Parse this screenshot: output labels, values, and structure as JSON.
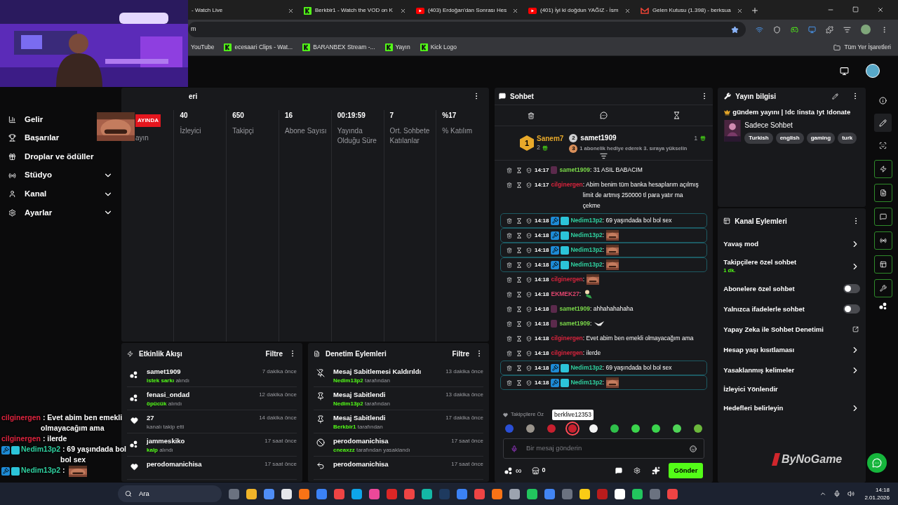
{
  "browser": {
    "tabs": [
      {
        "title": "- Watch Live",
        "selected": false
      },
      {
        "title": "Berkbir1 - Watch the VOD on K",
        "selected": false
      },
      {
        "title": "(403) Erdoğan'dan Sonrası Hes",
        "selected": false
      },
      {
        "title": "(401) İyi ki doğdun YAĞIZ - İsm",
        "selected": false
      },
      {
        "title": "Gelen Kutusu (1.398) - berksua",
        "selected": false
      }
    ],
    "address": "m",
    "bookmarks": [
      "YouTube",
      "ecesaari Clips - Wat...",
      "BARANBEX Stream -...",
      "Yayın",
      "Kick Logo"
    ],
    "all_bookmarks": "Tüm Yer İşaretleri"
  },
  "sidebar": [
    {
      "label": "Gelir",
      "kind": "link"
    },
    {
      "label": "Başarılar",
      "kind": "link"
    },
    {
      "label": "Droplar ve ödüller",
      "kind": "link"
    },
    {
      "label": "Stüdyo",
      "kind": "group",
      "expanded": false
    },
    {
      "label": "Kanal",
      "kind": "group",
      "expanded": false
    },
    {
      "label": "Ayarlar",
      "kind": "group",
      "expanded": false
    }
  ],
  "stats": {
    "title": "eri",
    "live_badge": "AYINDA",
    "live_label": "ayın",
    "items": [
      {
        "value": "40",
        "label": "İzleyici"
      },
      {
        "value": "650",
        "label": "Takipçi"
      },
      {
        "value": "16",
        "label": "Abone Sayısı"
      },
      {
        "value": "00:19:59",
        "label": "Yayında Olduğu Süre"
      },
      {
        "value": "7",
        "label": "Ort. Sohbete Katılanlar"
      },
      {
        "value": "%17",
        "label": "% Katılım"
      }
    ]
  },
  "activity": {
    "title": "Etkinlik Akışı",
    "filter": "Filtre",
    "items": [
      {
        "user": "samet1909",
        "kind": "gift",
        "highlight": "istek sarkı",
        "detail": "alındı",
        "time": "7 dakika önce"
      },
      {
        "user": "fenasi_ondad",
        "kind": "gift",
        "highlight": "öpücük",
        "detail": "alındı",
        "time": "12 dakika önce"
      },
      {
        "user": "27",
        "kind": "follow",
        "detail": "kanalı takip etti",
        "time": "14 dakika önce"
      },
      {
        "user": "jammeskiko",
        "kind": "gift",
        "highlight": "kalp",
        "detail": "alındı",
        "time": "17 saat önce"
      },
      {
        "user": "perodomanichisa",
        "kind": "follow",
        "time": "17 saat önce"
      }
    ]
  },
  "moderation": {
    "title": "Denetim Eylemleri",
    "filter": "Filtre",
    "items": [
      {
        "title": "Mesaj Sabitlemesi Kaldırıldı",
        "kind": "unpin",
        "actor": "Nedim13p2",
        "detail": "tarafından",
        "time": "13 dakika önce"
      },
      {
        "title": "Mesaj Sabitlendi",
        "kind": "pin",
        "actor": "Nedim13p2",
        "detail": "tarafından",
        "time": "13 dakika önce"
      },
      {
        "title": "Mesaj Sabitlendi",
        "kind": "pin",
        "actor": "Berkbir1",
        "detail": "tarafından",
        "time": "17 dakika önce"
      },
      {
        "title": "perodomanichisa",
        "kind": "ban",
        "actor": "cneaxzz",
        "detail": "tarafından yasaklandı",
        "time": "17 saat önce"
      },
      {
        "title": "perodomanichisa",
        "kind": "undo",
        "time": "17 saat önce"
      }
    ]
  },
  "chat": {
    "title": "Sohbet",
    "leader": {
      "rank": "1",
      "name": "Sanem7",
      "count": "2"
    },
    "runner_up": {
      "rank": "2",
      "name": "samet1909",
      "count": "1"
    },
    "next": {
      "rank": "3",
      "text": "1 abonelik hediye ederek 3. sıraya yükselin"
    },
    "messages": [
      {
        "time": "14:17",
        "user": "samet1909",
        "color": "#7bd94a",
        "avatar": true,
        "badges": false,
        "highlighted": false,
        "text": ": 31 ASIL BABACIM",
        "kind": "text"
      },
      {
        "time": "14:17",
        "user": "cilginergen",
        "color": "#d9243d",
        "avatar": false,
        "badges": false,
        "highlighted": false,
        "text": ": Abim benim tüm banka hesaplarım açılmış limit de artmış 250000 tl para yatır ma çekme",
        "kind": "text"
      },
      {
        "time": "14:18",
        "user": "Nedim13p2",
        "color": "#2fcf9f",
        "avatar": false,
        "badges": true,
        "highlighted": true,
        "text": ": 69 yaşındada bol bol sex",
        "kind": "text"
      },
      {
        "time": "14:18",
        "user": "Nedim13p2",
        "color": "#2fcf9f",
        "avatar": false,
        "badges": true,
        "highlighted": true,
        "text": ":",
        "kind": "face"
      },
      {
        "time": "14:18",
        "user": "Nedim13p2",
        "color": "#2fcf9f",
        "avatar": false,
        "badges": true,
        "highlighted": true,
        "text": ":",
        "kind": "face"
      },
      {
        "time": "14:18",
        "user": "Nedim13p2",
        "color": "#2fcf9f",
        "avatar": false,
        "badges": true,
        "highlighted": true,
        "text": ":",
        "kind": "face"
      },
      {
        "time": "14:18",
        "user": "cilginergen",
        "color": "#d9243d",
        "avatar": false,
        "badges": false,
        "highlighted": false,
        "text": ":",
        "kind": "face"
      },
      {
        "time": "14:18",
        "user": "EKMEK27",
        "color": "#e0456e",
        "avatar": false,
        "badges": false,
        "highlighted": false,
        "text": ":",
        "kind": "figure"
      },
      {
        "time": "14:18",
        "user": "samet1909",
        "color": "#7bd94a",
        "avatar": true,
        "badges": false,
        "highlighted": false,
        "text": ": ahhahahahaha",
        "kind": "text"
      },
      {
        "time": "14:18",
        "user": "samet1909",
        "color": "#7bd94a",
        "avatar": true,
        "badges": false,
        "highlighted": false,
        "text": ":",
        "kind": "bird"
      },
      {
        "time": "14:18",
        "user": "cilginergen",
        "color": "#d9243d",
        "avatar": false,
        "badges": false,
        "highlighted": false,
        "text": ": Evet abim ben emekli olmayacağım ama",
        "kind": "text"
      },
      {
        "time": "14:18",
        "user": "cilginergen",
        "color": "#d9243d",
        "avatar": false,
        "badges": false,
        "highlighted": false,
        "text": ": ilerde",
        "kind": "text"
      },
      {
        "time": "14:18",
        "user": "Nedim13p2",
        "color": "#2fcf9f",
        "avatar": false,
        "badges": true,
        "highlighted": true,
        "text": ": 69 yaşındada bol bol sex",
        "kind": "text"
      },
      {
        "time": "14:18",
        "user": "Nedim13p2",
        "color": "#2fcf9f",
        "avatar": false,
        "badges": true,
        "highlighted": true,
        "text": ":",
        "kind": "face"
      }
    ],
    "emote_label": "Takipçilere Öz",
    "tooltip": "berklive12353",
    "emotes": [
      {
        "color": "#2a4fd6",
        "hovered": false
      },
      {
        "color": "#9a948c",
        "hovered": false
      },
      {
        "color": "#c8202f",
        "hovered": false
      },
      {
        "color": "#c8202e",
        "hovered": true
      },
      {
        "color": "#f4f4f4",
        "hovered": false
      },
      {
        "color": "#2fbf4a",
        "hovered": false
      },
      {
        "color": "#3bd44c",
        "hovered": false
      },
      {
        "color": "#3bd44d",
        "hovered": false
      },
      {
        "color": "#4fd457",
        "hovered": false
      },
      {
        "color": "#6bb83c",
        "hovered": false
      }
    ],
    "input": {
      "placeholder": "Bir mesaj gönderin"
    },
    "points": "∞",
    "store_count": "0",
    "send": "Gönder"
  },
  "stream_info": {
    "title": "Yayın bilgisi",
    "stream_title": "gündem yayını | !dc !insta !yt !donate",
    "category": "Sadece Sohbet",
    "tags": [
      "Turkish",
      "english",
      "gaming",
      "turk"
    ]
  },
  "channel_actions": {
    "title": "Kanal Eylemleri",
    "items": [
      {
        "label": "Yavaş mod",
        "kind": "link"
      },
      {
        "label": "Takipçilere özel sohbet",
        "kind": "link",
        "sub": "1 dk."
      },
      {
        "label": "Abonelere özel sohbet",
        "kind": "toggle",
        "on": false
      },
      {
        "label": "Yalnızca ifadelerle sohbet",
        "kind": "toggle",
        "on": false
      },
      {
        "label": "Yapay Zeka ile Sohbet Denetimi",
        "kind": "external"
      },
      {
        "label": "Hesap yaşı kısıtlaması",
        "kind": "link"
      },
      {
        "label": "Yasaklanmış kelimeler",
        "kind": "link"
      },
      {
        "label": "İzleyici Yönlendir",
        "kind": "plain"
      },
      {
        "label": "Hedefleri belirleyin",
        "kind": "link"
      }
    ]
  },
  "overlay_chat": [
    {
      "user": "cilginergen",
      "color": "#e0243f",
      "badges": false,
      "text": " : Evet abim ben emekli olmayacağım ama",
      "kind": "text"
    },
    {
      "user": "cilginergen",
      "color": "#e0243f",
      "badges": false,
      "text": " : ilerde",
      "kind": "text"
    },
    {
      "user": "Nedim13p2",
      "color": "#2fcf9f",
      "badges": true,
      "text": " : 69 yaşındada bol bol sex",
      "kind": "text"
    },
    {
      "user": "Nedim13p2",
      "color": "#2fcf9f",
      "badges": true,
      "text": " :",
      "kind": "face"
    }
  ],
  "logo": "ByNoGame",
  "taskbar": {
    "search": "Ara",
    "time": "14:18",
    "date": "2.01.2026"
  }
}
